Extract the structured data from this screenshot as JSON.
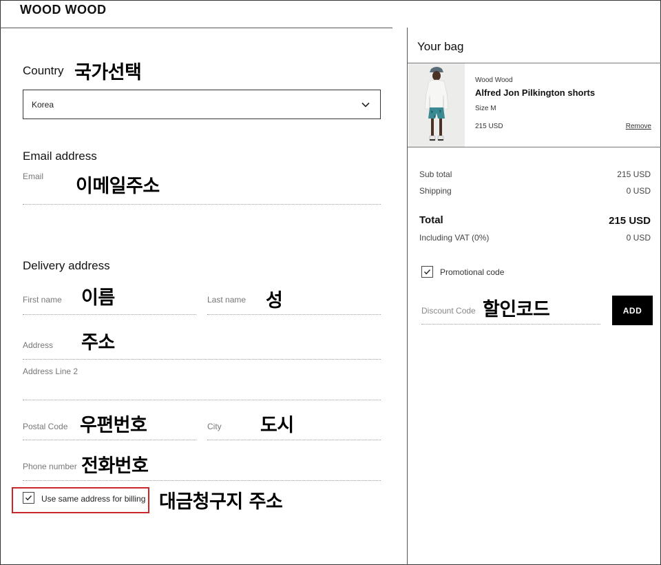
{
  "brand": "WOOD WOOD",
  "country": {
    "heading": "Country",
    "annotation": "국가선택",
    "selected": "Korea"
  },
  "email": {
    "heading": "Email address",
    "label": "Email",
    "annotation": "이메일주소"
  },
  "delivery": {
    "heading": "Delivery address",
    "first_name_label": "First name",
    "first_name_annotation": "이름",
    "last_name_label": "Last name",
    "last_name_annotation": "성",
    "address_label": "Address",
    "address_annotation": "주소",
    "address2_label": "Address Line 2",
    "postal_label": "Postal Code",
    "postal_annotation": "우편번호",
    "city_label": "City",
    "city_annotation": "도시",
    "phone_label": "Phone number",
    "phone_annotation": "전화번호"
  },
  "billing": {
    "label": "Use same address for billing",
    "checked": true,
    "annotation": "대금청구지 주소"
  },
  "bag": {
    "title": "Your bag",
    "item": {
      "brand": "Wood Wood",
      "name": "Alfred Jon Pilkington shorts",
      "size": "Size M",
      "price": "215 USD",
      "remove": "Remove"
    },
    "summary": {
      "subtotal_label": "Sub total",
      "subtotal_value": "215 USD",
      "shipping_label": "Shipping",
      "shipping_value": "0 USD",
      "total_label": "Total",
      "total_value": "215 USD",
      "vat_label": "Including VAT (0%)",
      "vat_value": "0 USD"
    },
    "promo": {
      "label": "Promotional code",
      "checked": true,
      "discount_label": "Discount Code",
      "discount_annotation": "할인코드",
      "add_button": "ADD"
    }
  },
  "colors": {
    "highlight_border": "#c9262c",
    "button_bg": "#000000"
  }
}
